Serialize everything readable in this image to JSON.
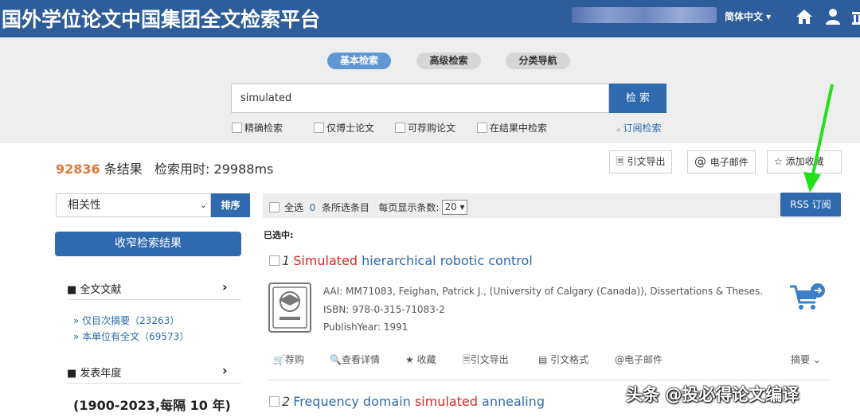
{
  "header": {
    "site_title": "国外学位论文中国集团全文检索平台",
    "language": "简体中文 ▾",
    "icons": [
      "home-icon",
      "user-icon",
      "library-icon"
    ]
  },
  "search": {
    "tabs": [
      "基本检索",
      "高级检索",
      "分类导航"
    ],
    "query": "simulated",
    "button": "检 索",
    "options": [
      "精确检索",
      "仅博士论文",
      "可荐购论文",
      "在结果中检索"
    ],
    "rss_subscribe": "订阅检索"
  },
  "summary": {
    "count": "92836",
    "count_suffix": "条结果",
    "time_label": "检索用时:",
    "time_value": "29988ms",
    "export_citation": "引文导出",
    "email": "电子邮件",
    "favorite": "添加收藏"
  },
  "sidebar": {
    "sort_value": "相关性",
    "sort_button": "排序",
    "narrow_button": "收窄检索结果",
    "fulltext_heading": "全文文献",
    "links": [
      "» 仅目次摘要（23263）",
      "» 本单位有全文（69573）"
    ],
    "year_heading": "发表年度",
    "year_range": "(1900-2023,每隔 10 年)"
  },
  "results_toolbar": {
    "select_all": "全选",
    "selected_count": "0",
    "selected_suffix": "条所选条目",
    "per_page_label": "每页显示条数:",
    "per_page_value": "20",
    "rss_button": "RSS 订阅",
    "selected_label": "已选中:"
  },
  "results": [
    {
      "number": "1",
      "title_parts": [
        "Simulated",
        " hierarchical robotic control"
      ],
      "aai": "AAI: MM71083, Feighan, Patrick J., (University of Calgary (Canada)), Dissertations & Theses.",
      "isbn": "ISBN: 978-0-315-71083-2",
      "year": "PublishYear: 1991",
      "actions": [
        "荐购",
        "查看详情",
        "收藏",
        "引文导出",
        "引文格式",
        "电子邮件",
        "摘要 ⌄"
      ]
    },
    {
      "number": "2",
      "title_parts": [
        "Frequency domain ",
        "simulated",
        " annealing"
      ]
    }
  ],
  "watermark": "头条 @投必得论文编译",
  "colors": {
    "header": "#2d5e9b",
    "accent": "#2e6aad",
    "highlight": "#e02424",
    "count": "#e0783a"
  }
}
